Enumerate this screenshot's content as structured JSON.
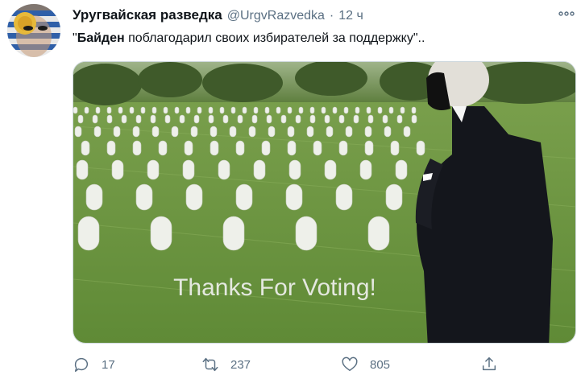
{
  "tweet": {
    "display_name": "Уругвайская разведка",
    "handle": "@UrgvRazvedka",
    "separator": "·",
    "time": "12 ч",
    "text_open_quote": "\"",
    "text_bold": "Байден",
    "text_rest": " поблагодарил своих избирателей за поддержку\"..",
    "media_caption": "Thanks For Voting!"
  },
  "actions": {
    "reply_count": "17",
    "retweet_count": "237",
    "like_count": "805"
  },
  "icons": {
    "more": "more-icon",
    "reply": "reply-icon",
    "retweet": "retweet-icon",
    "like": "heart-icon",
    "share": "share-icon"
  },
  "colors": {
    "text_primary": "#0f1419",
    "text_secondary": "#5b7083",
    "grass": "#6f9a44",
    "flag_blue": "#2f5fa8",
    "flag_sun": "#e7b93a"
  }
}
